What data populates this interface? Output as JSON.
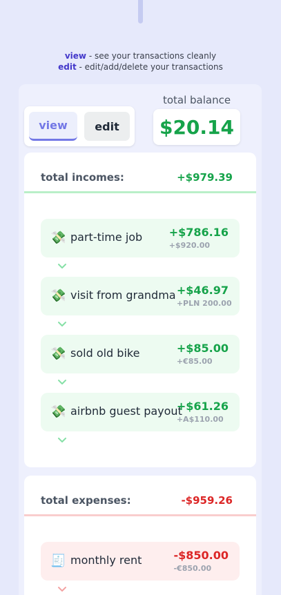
{
  "help": {
    "view_word": "view",
    "view_text": " - see your transactions cleanly",
    "edit_word": "edit",
    "edit_text": " - edit/add/delete your transactions"
  },
  "modes": {
    "view_label": "view",
    "edit_label": "edit",
    "active": "view"
  },
  "balance": {
    "label": "total balance",
    "value": "$20.14"
  },
  "incomes": {
    "title": "total incomes:",
    "total": "+$979.39",
    "items": [
      {
        "icon": "money-with-wings-icon",
        "glyph": "💸",
        "name": "part-time job",
        "amount": "+$786.16",
        "original": "+$920.00"
      },
      {
        "icon": "money-with-wings-icon",
        "glyph": "💸",
        "name": "visit from grandma",
        "amount": "+$46.97",
        "original": "+PLN 200.00"
      },
      {
        "icon": "money-with-wings-icon",
        "glyph": "💸",
        "name": "sold old bike",
        "amount": "+$85.00",
        "original": "+€85.00"
      },
      {
        "icon": "money-with-wings-icon",
        "glyph": "💸",
        "name": "airbnb guest payout",
        "amount": "+$61.26",
        "original": "+A$110.00"
      }
    ]
  },
  "expenses": {
    "title": "total expenses:",
    "total": "-$959.26",
    "items": [
      {
        "icon": "receipt-icon",
        "glyph": "🧾",
        "name": "monthly rent",
        "amount": "-$850.00",
        "original": "-€850.00"
      }
    ]
  },
  "colors": {
    "income": "#16a34a",
    "expense": "#dc2626",
    "accent": "#7378e6"
  }
}
